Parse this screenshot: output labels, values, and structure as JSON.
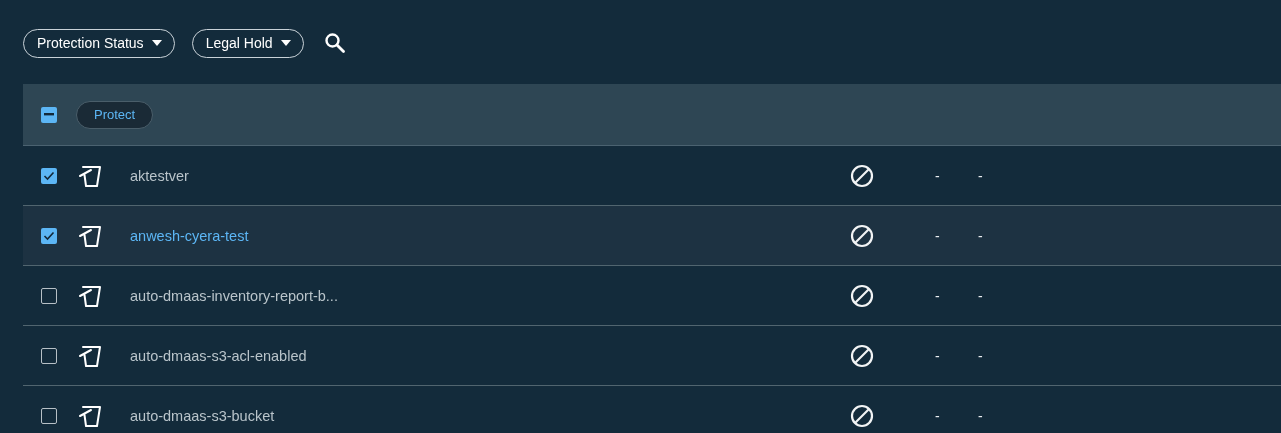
{
  "filters": [
    {
      "label": "Protection Status"
    },
    {
      "label": "Legal Hold"
    }
  ],
  "header": {
    "indeterminate": true,
    "action": "Protect"
  },
  "rows": [
    {
      "name": "aktestver",
      "checked": true,
      "highlighted": false,
      "column_3": "-",
      "column_4": "-"
    },
    {
      "name": "anwesh-cyera-test",
      "checked": true,
      "highlighted": true,
      "column_3": "-",
      "column_4": "-"
    },
    {
      "name": "auto-dmaas-inventory-report-b...",
      "checked": false,
      "highlighted": false,
      "column_3": "-",
      "column_4": "-"
    },
    {
      "name": "auto-dmaas-s3-acl-enabled",
      "checked": false,
      "highlighted": false,
      "column_3": "-",
      "column_4": "-"
    },
    {
      "name": "auto-dmaas-s3-bucket",
      "checked": false,
      "highlighted": false,
      "column_3": "-",
      "column_4": "-"
    }
  ]
}
